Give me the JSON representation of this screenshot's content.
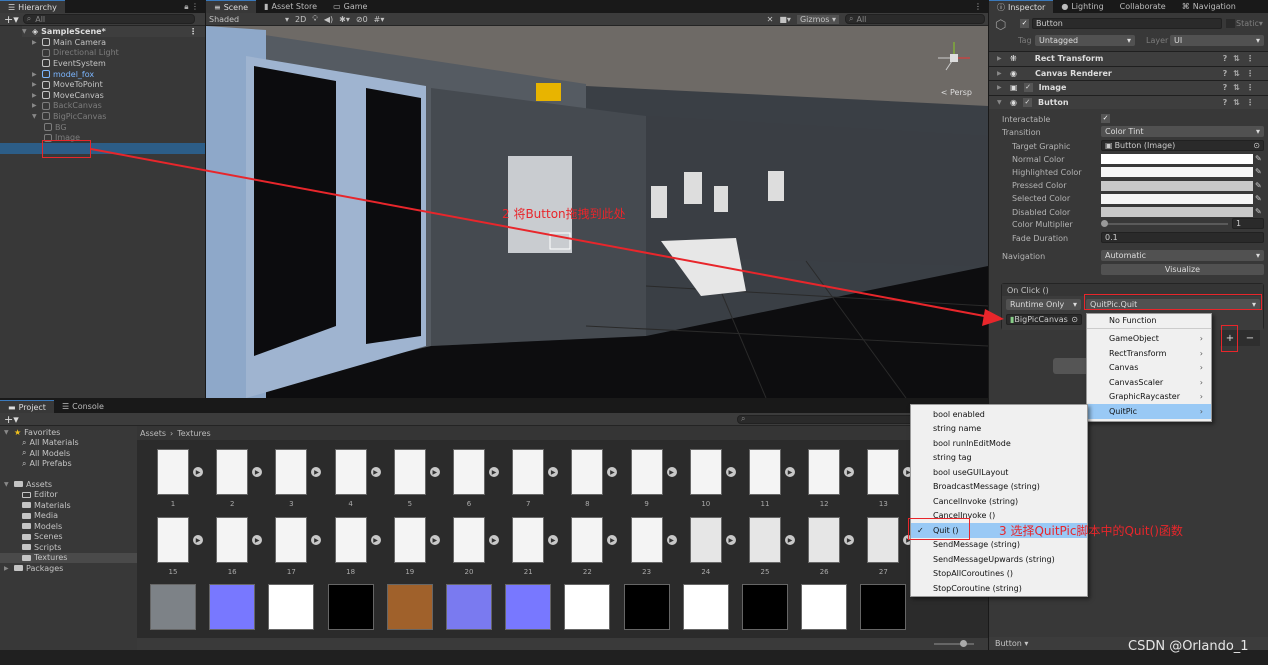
{
  "hierarchy": {
    "tab": "Hierarchy",
    "search_placeholder": "All",
    "scene": "SampleScene*",
    "items": [
      {
        "label": "Main Camera",
        "state": "normal",
        "expand": true
      },
      {
        "label": "Directional Light",
        "state": "dim",
        "expand": false
      },
      {
        "label": "EventSystem",
        "state": "normal",
        "expand": false
      },
      {
        "label": "model_fox",
        "state": "prefab",
        "expand": true
      },
      {
        "label": "MoveToPoint",
        "state": "normal",
        "expand": true
      },
      {
        "label": "MoveCanvas",
        "state": "normal",
        "expand": true
      },
      {
        "label": "BackCanvas",
        "state": "dim",
        "expand": true
      },
      {
        "label": "BigPicCanvas",
        "state": "dim",
        "expand": true
      },
      {
        "label": "BG",
        "state": "dim",
        "child": true
      },
      {
        "label": "Image",
        "state": "dim",
        "child": true
      },
      {
        "label": "Button",
        "state": "selected",
        "child": true
      }
    ]
  },
  "scene": {
    "tabs": [
      "Scene",
      "Asset Store",
      "Game"
    ],
    "shading": "Shaded",
    "mode_2d": "2D",
    "hidden_count": "0",
    "gizmos": "Gizmos",
    "search_placeholder": "All",
    "persp": "< Persp"
  },
  "inspector": {
    "tabs": [
      "Inspector",
      "Lighting",
      "Collaborate",
      "Navigation"
    ],
    "object_name": "Button",
    "static_label": "Static",
    "tag_label": "Tag",
    "tag": "Untagged",
    "layer_label": "Layer",
    "layer": "UI",
    "components": [
      "Rect Transform",
      "Canvas Renderer",
      "Image",
      "Button"
    ],
    "button": {
      "interactable_label": "Interactable",
      "interactable": true,
      "transition_label": "Transition",
      "transition": "Color Tint",
      "target_graphic_label": "Target Graphic",
      "target_graphic": "Button (Image)",
      "colors": [
        {
          "label": "Normal Color",
          "value": "#ffffff"
        },
        {
          "label": "Highlighted Color",
          "value": "#f5f5f5"
        },
        {
          "label": "Pressed Color",
          "value": "#c8c8c8"
        },
        {
          "label": "Selected Color",
          "value": "#f5f5f5"
        },
        {
          "label": "Disabled Color",
          "value": "#c8c8c8"
        }
      ],
      "multiplier_label": "Color Multiplier",
      "multiplier": "1",
      "fade_label": "Fade Duration",
      "fade": "0.1",
      "navigation_label": "Navigation",
      "navigation": "Automatic",
      "visualize": "Visualize",
      "onclick_label": "On Click ()",
      "runtime": "Runtime Only",
      "function": "QuitPic.Quit",
      "target_object": "BigPicCanvas"
    },
    "footer_label": "Button"
  },
  "function_menu": {
    "items": [
      {
        "label": "No Function",
        "submenu": false
      },
      {
        "label": "GameObject",
        "submenu": true
      },
      {
        "label": "RectTransform",
        "submenu": true
      },
      {
        "label": "Canvas",
        "submenu": true
      },
      {
        "label": "CanvasScaler",
        "submenu": true
      },
      {
        "label": "GraphicRaycaster",
        "submenu": true
      },
      {
        "label": "QuitPic",
        "submenu": true,
        "selected": true
      }
    ]
  },
  "quitpic_menu": {
    "items": [
      "bool enabled",
      "string name",
      "bool runInEditMode",
      "string tag",
      "bool useGUILayout",
      "BroadcastMessage (string)",
      "CancelInvoke (string)",
      "CancelInvoke ()",
      "Quit ()",
      "SendMessage (string)",
      "SendMessageUpwards (string)",
      "StopAllCoroutines ()",
      "StopCoroutine (string)"
    ],
    "checked": "Quit ()"
  },
  "project": {
    "tabs": [
      "Project",
      "Console"
    ],
    "favorites": "Favorites",
    "favorite_items": [
      "All Materials",
      "All Models",
      "All Prefabs"
    ],
    "assets": "Assets",
    "asset_folders": [
      "Editor",
      "Materials",
      "Media",
      "Models",
      "Scenes",
      "Scripts",
      "Textures"
    ],
    "packages": "Packages",
    "breadcrumb": [
      "Assets",
      "Textures"
    ],
    "row1": [
      "1",
      "2",
      "3",
      "4",
      "5",
      "6",
      "7",
      "8",
      "9",
      "10",
      "11",
      "12",
      "13"
    ],
    "row2": [
      "15",
      "16",
      "17",
      "18",
      "19",
      "20",
      "21",
      "22",
      "23",
      "24",
      "25",
      "26",
      "27"
    ],
    "row3_colors": [
      "#7d8287",
      "#7878ff",
      "#ffffff",
      "#000000",
      "#a0612b",
      "#7a7af0",
      "#7878ff",
      "#ffffff",
      "#000000",
      "#ffffff",
      "#000000",
      "#ffffff",
      "#000000"
    ]
  },
  "annotations": {
    "step2": "2 将Button拖拽到此处",
    "step3": "3 选择QuitPic脚本中的Quit()函数",
    "color": "#e8262b"
  },
  "watermark": "CSDN @Orlando_1"
}
